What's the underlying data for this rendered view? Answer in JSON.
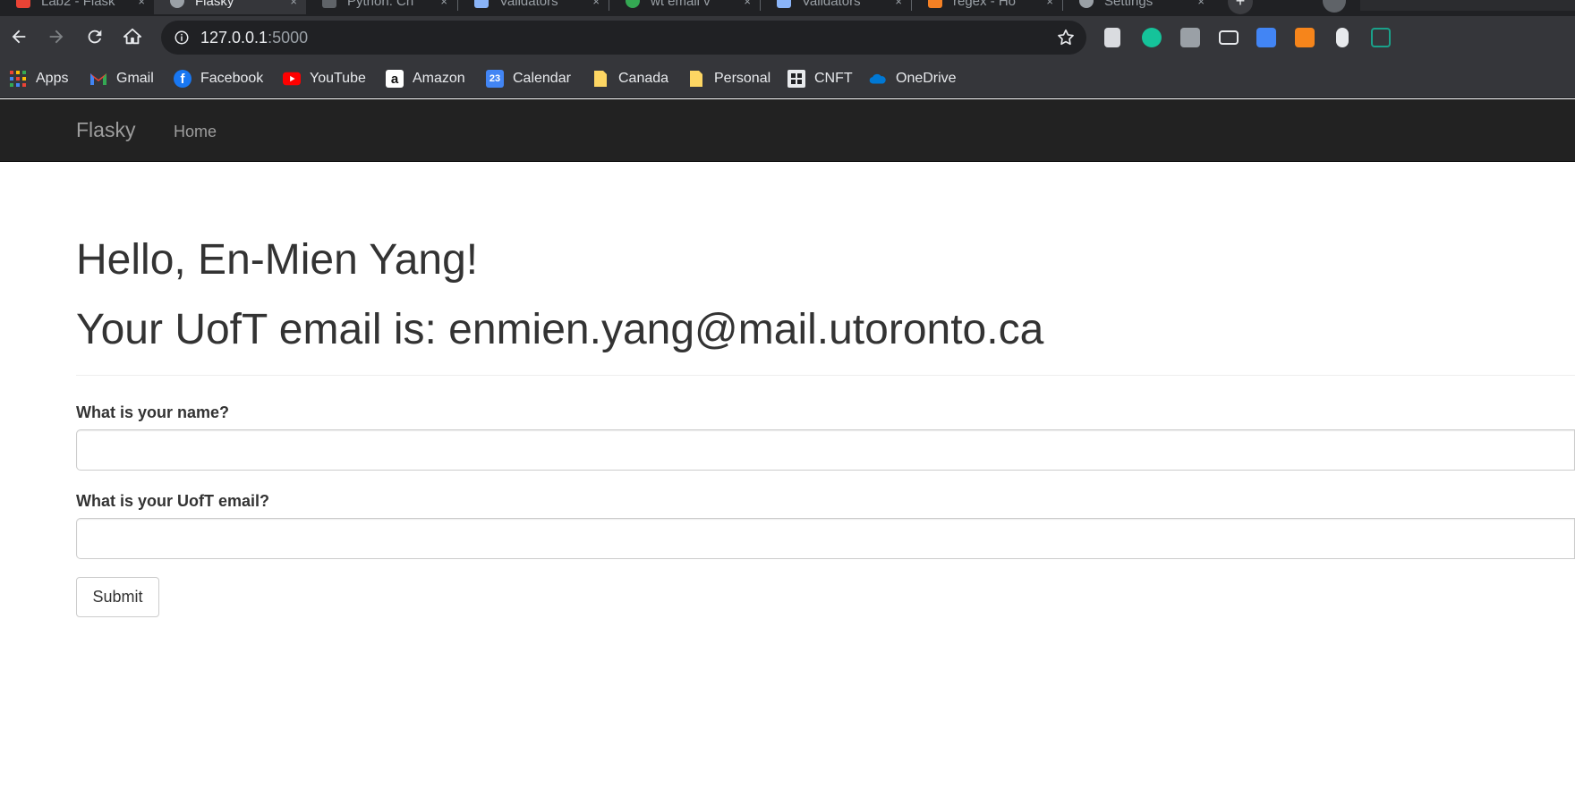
{
  "browser": {
    "tabs": [
      {
        "title": "Lab2 - Flask",
        "favicon_color": "#ea4335",
        "active": false
      },
      {
        "title": "Flasky",
        "favicon_color": "#9aa0a6",
        "active": true
      },
      {
        "title": "Python: Ch",
        "favicon_color": "#5f6368",
        "active": false
      },
      {
        "title": "Validators",
        "favicon_color": "#8ab4f8",
        "active": false
      },
      {
        "title": "wt email v",
        "favicon_color": "#34a853",
        "active": false
      },
      {
        "title": "Validators",
        "favicon_color": "#8ab4f8",
        "active": false
      },
      {
        "title": "regex - Ho",
        "favicon_color": "#f48024",
        "active": false
      },
      {
        "title": "Settings",
        "favicon_color": "#9aa0a6",
        "active": false
      }
    ],
    "new_tab_symbol": "+",
    "close_symbol": "×",
    "url_host": "127.0.0.1",
    "url_port": ":5000",
    "extensions": [
      {
        "name": "page-extension-icon",
        "color": "#dadce0"
      },
      {
        "name": "grammarly-icon",
        "color": "#15c39a"
      },
      {
        "name": "font-extension-icon",
        "color": "#9aa0a6"
      },
      {
        "name": "clapper-icon",
        "color": "#202124"
      },
      {
        "name": "window-extension-icon",
        "color": "#4285f4"
      },
      {
        "name": "metamask-icon",
        "color": "#f6851b"
      },
      {
        "name": "mouse-extension-icon",
        "color": "#e8eaed"
      },
      {
        "name": "n-extension-icon",
        "color": "#1aa18a"
      }
    ],
    "bookmarks": [
      {
        "label": "Apps",
        "icon": "apps-grid-icon",
        "color": "#ea4335"
      },
      {
        "label": "Gmail",
        "icon": "gmail-icon",
        "color": "#ea4335"
      },
      {
        "label": "Facebook",
        "icon": "facebook-icon",
        "color": "#1877f2"
      },
      {
        "label": "YouTube",
        "icon": "youtube-icon",
        "color": "#ff0000"
      },
      {
        "label": "Amazon",
        "icon": "amazon-icon",
        "color": "#ffffff"
      },
      {
        "label": "Calendar",
        "icon": "calendar-icon",
        "color": "#4285f4"
      },
      {
        "label": "Canada",
        "icon": "folder-icon",
        "color": "#fdd663"
      },
      {
        "label": "Personal",
        "icon": "folder-icon",
        "color": "#fdd663"
      },
      {
        "label": "CNFT",
        "icon": "cnft-icon",
        "color": "#202124"
      },
      {
        "label": "OneDrive",
        "icon": "onedrive-icon",
        "color": "#0078d4"
      }
    ]
  },
  "navbar": {
    "brand": "Flasky",
    "home": "Home"
  },
  "main": {
    "greeting": "Hello, En-Mien Yang!",
    "email_line": "Your UofT email is: enmien.yang@mail.utoronto.ca",
    "form": {
      "name_label": "What is your name?",
      "name_value": "",
      "email_label": "What is your UofT email?",
      "email_value": "",
      "submit_label": "Submit"
    }
  }
}
